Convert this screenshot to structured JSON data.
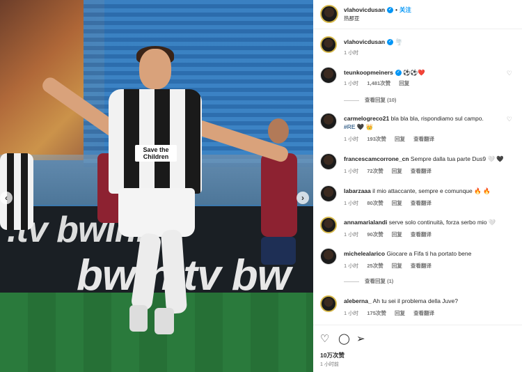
{
  "header": {
    "username": "vlahovicdusan",
    "follow_label": "关注",
    "location": "热那亚"
  },
  "carousel": {
    "prev": "‹",
    "next": "›"
  },
  "photo": {
    "sponsor": "Save the Children",
    "board_text_1": ".tv  bwin.tv",
    "board_text_2": "bwin.tv  bw"
  },
  "comments": [
    {
      "user": "vlahovicdusan",
      "verified": true,
      "text": "🌪️",
      "time": "1 小时",
      "likes": "",
      "reply": "",
      "translate": "",
      "view_replies": ""
    },
    {
      "user": "teunkoopmeiners",
      "verified": true,
      "text": "⚽⚽❤️",
      "time": "1 小时",
      "likes": "1,481次赞",
      "reply": "回复",
      "translate": "",
      "view_replies": "查看回复 (10)"
    },
    {
      "user": "carmelogreco21",
      "verified": false,
      "text": "bla bla bla, rispondiamo sul campo.",
      "hashtag": "#RE",
      "text2": "🖤 👑",
      "time": "1 小时",
      "likes": "193次赞",
      "reply": "回复",
      "translate": "查看翻译",
      "view_replies": ""
    },
    {
      "user": "francescamcorrone_cn",
      "verified": false,
      "text": "Sempre dalla tua parte Dus9 🤍 🖤",
      "time": "1 小时",
      "likes": "72次赞",
      "reply": "回复",
      "translate": "查看翻译",
      "view_replies": ""
    },
    {
      "user": "labarzaaa",
      "verified": false,
      "text": "il mio attaccante, sempre e comunque 🔥 🔥",
      "time": "1 小时",
      "likes": "80次赞",
      "reply": "回复",
      "translate": "查看翻译",
      "view_replies": ""
    },
    {
      "user": "annamarialandi",
      "verified": false,
      "text": "serve solo continuità, forza serbo mio 🤍",
      "time": "1 小时",
      "likes": "90次赞",
      "reply": "回复",
      "translate": "查看翻译",
      "view_replies": ""
    },
    {
      "user": "michelealarico",
      "verified": false,
      "text": "Giocare a Fifa ti ha portato bene",
      "time": "1 小时",
      "likes": "25次赞",
      "reply": "回复",
      "translate": "查看翻译",
      "view_replies": "查看回复 (1)"
    },
    {
      "user": "aleberna_",
      "verified": false,
      "text": "Ah tu sei il problema della Juve?",
      "time": "1 小时",
      "likes": "175次赞",
      "reply": "回复",
      "translate": "查看翻译",
      "view_replies": ""
    }
  ],
  "actions": {
    "like_icon": "heart-icon",
    "comment_icon": "comment-icon",
    "share_icon": "share-icon",
    "likes": "10万次赞",
    "time": "1 小时前"
  }
}
